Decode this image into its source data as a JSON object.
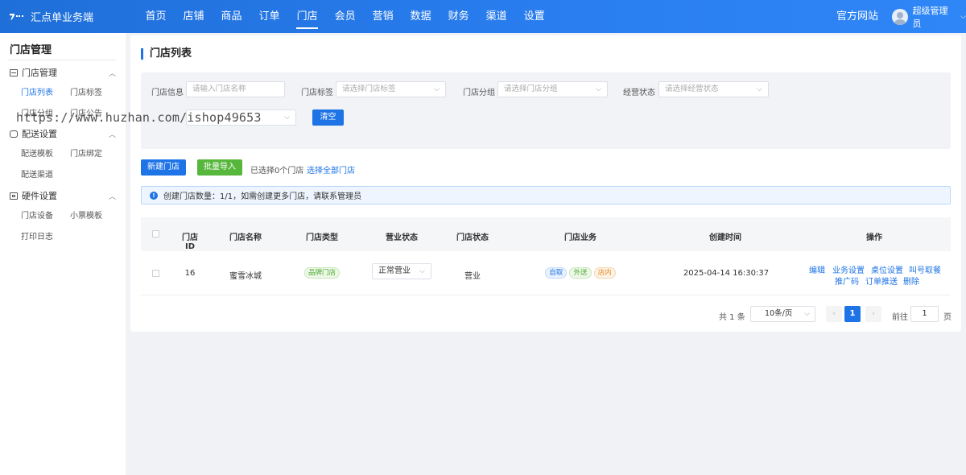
{
  "header": {
    "brand": "汇点单业务端",
    "nav": [
      "首页",
      "店铺",
      "商品",
      "订单",
      "门店",
      "会员",
      "营销",
      "数据",
      "财务",
      "渠道",
      "设置"
    ],
    "active_nav": "门店",
    "official_site": "官方网站",
    "user_name": "超级管理员"
  },
  "sidebar": {
    "title": "门店管理",
    "groups": [
      {
        "label": "门店管理",
        "items": [
          "门店列表",
          "门店标签",
          "门店分组",
          "门店公告"
        ]
      },
      {
        "label": "配送设置",
        "items": [
          "配送模板",
          "门店绑定",
          "配送渠道"
        ]
      },
      {
        "label": "硬件设置",
        "items": [
          "门店设备",
          "小票模板",
          "打印日志"
        ]
      }
    ],
    "active_item": "门店列表"
  },
  "page": {
    "title": "门店列表",
    "filters": {
      "store_info": {
        "label": "门店信息",
        "placeholder": "请输入门店名称"
      },
      "store_tag": {
        "label": "门店标签",
        "placeholder": "请选择门店标签"
      },
      "store_group": {
        "label": "门店分组",
        "placeholder": "请选择门店分组"
      },
      "biz_status": {
        "label": "经营状态",
        "placeholder": "请选择经营状态"
      },
      "clear_label": "清空"
    },
    "actions": {
      "new_store": "新建门店",
      "bulk_import": "批量导入",
      "selected_text": "已选择0个门店",
      "select_all": "选择全部门店"
    },
    "notice": "创建门店数量：1/1，如需创建更多门店，请联系管理员",
    "table": {
      "columns": [
        "门店ID",
        "门店名称",
        "门店类型",
        "营业状态",
        "门店状态",
        "门店业务",
        "创建时间",
        "操作"
      ],
      "rows": [
        {
          "id": "16",
          "name": "蜜雪冰城",
          "type": "品牌门店",
          "biz_status": "正常营业",
          "store_status": "营业",
          "services": [
            "自取",
            "外送",
            "店内"
          ],
          "created": "2025-04-14 16:30:37",
          "ops": [
            "编辑",
            "业务设置",
            "桌位设置",
            "叫号取餐",
            "推广码",
            "订单推送",
            "删除"
          ]
        }
      ]
    },
    "pagination": {
      "total": "共 1 条",
      "page_size": "10条/页",
      "current": "1",
      "goto_prefix": "前往",
      "goto_value": "1",
      "goto_suffix": "页"
    }
  },
  "watermark": "https://www.huzhan.com/ishop49653",
  "colors": {
    "primary": "#1e74e6",
    "success": "#57b73c",
    "header_bg": "#2a7ef0"
  }
}
